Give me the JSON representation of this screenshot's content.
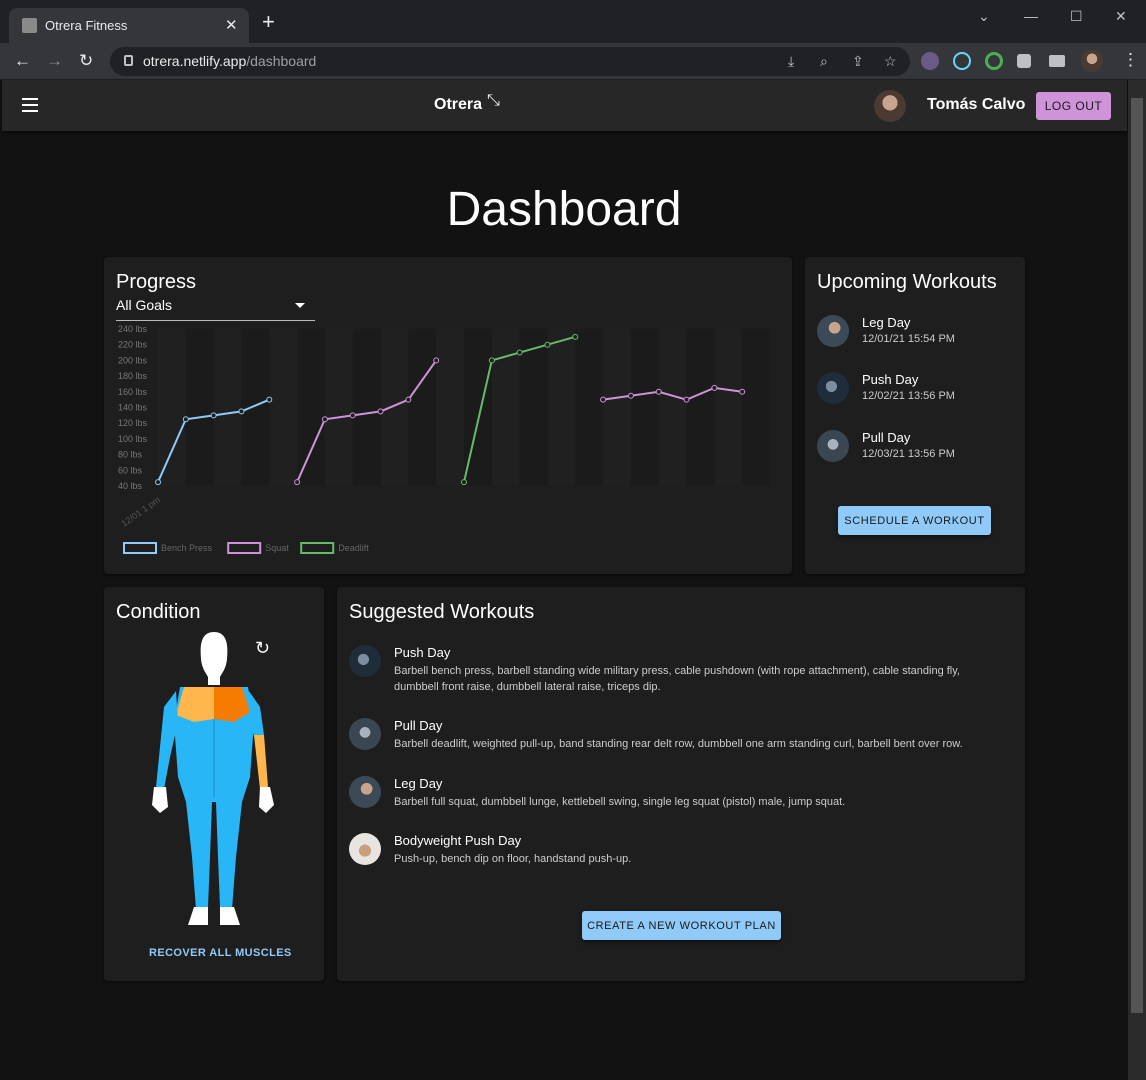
{
  "browser": {
    "tab_title": "Otrera Fitness",
    "url_host": "otrera.netlify.app",
    "url_path": "/dashboard"
  },
  "appbar": {
    "brand": "Otrera",
    "user_name": "Tomás Calvo",
    "logout_label": "LOG OUT"
  },
  "page_title": "Dashboard",
  "progress": {
    "title": "Progress",
    "goal_select": "All Goals",
    "chart_data": {
      "type": "line",
      "ylabel": "",
      "xlabel": "",
      "ylim": [
        40,
        240
      ],
      "y_ticks": [
        "240 lbs",
        "220 lbs",
        "200 lbs",
        "180 lbs",
        "160 lbs",
        "140 lbs",
        "120 lbs",
        "100 lbs",
        "80 lbs",
        "60 lbs",
        "40 lbs"
      ],
      "x_tick_labels": [
        "12/01 1 pm"
      ],
      "legend": "bottom-left",
      "grid": true,
      "series": [
        {
          "name": "Bench Press",
          "color": "#90caf9",
          "points": [
            [
              0,
              45
            ],
            [
              1,
              125
            ],
            [
              2,
              130
            ],
            [
              3,
              135
            ],
            [
              4,
              150
            ]
          ]
        },
        {
          "name": "Squat",
          "color": "#ce93d8",
          "points": [
            [
              5,
              45
            ],
            [
              6,
              125
            ],
            [
              7,
              130
            ],
            [
              8,
              135
            ],
            [
              9,
              150
            ],
            [
              10,
              200
            ]
          ]
        },
        {
          "name": "Deadlift",
          "color": "#66bb6a",
          "points": [
            [
              11,
              45
            ],
            [
              12,
              200
            ],
            [
              13,
              210
            ],
            [
              14,
              220
            ],
            [
              15,
              230
            ]
          ]
        },
        {
          "name": "",
          "color": "#ce93d8",
          "points": [
            [
              16,
              150
            ],
            [
              17,
              155
            ],
            [
              18,
              160
            ],
            [
              19,
              150
            ],
            [
              20,
              165
            ],
            [
              21,
              160
            ]
          ]
        }
      ]
    }
  },
  "upcoming": {
    "title": "Upcoming Workouts",
    "items": [
      {
        "name": "Leg Day",
        "date": "12/01/21 15:54 PM"
      },
      {
        "name": "Push Day",
        "date": "12/02/21 13:56 PM"
      },
      {
        "name": "Pull Day",
        "date": "12/03/21 13:56 PM"
      }
    ],
    "schedule_label": "SCHEDULE A WORKOUT"
  },
  "condition": {
    "title": "Condition",
    "recover_label": "RECOVER ALL MUSCLES"
  },
  "suggested": {
    "title": "Suggested Workouts",
    "items": [
      {
        "name": "Push Day",
        "desc": "Barbell bench press, barbell standing wide military press, cable pushdown (with rope attachment), cable standing fly, dumbbell front raise, dumbbell lateral raise, triceps dip."
      },
      {
        "name": "Pull Day",
        "desc": "Barbell deadlift, weighted pull-up, band standing rear delt row, dumbbell one arm standing curl, barbell bent over row."
      },
      {
        "name": "Leg Day",
        "desc": "Barbell full squat, dumbbell lunge, kettlebell swing, single leg squat (pistol) male, jump squat."
      },
      {
        "name": "Bodyweight Push Day",
        "desc": "Push-up, bench dip on floor, handstand push-up."
      }
    ],
    "create_label": "CREATE A NEW WORKOUT PLAN"
  }
}
